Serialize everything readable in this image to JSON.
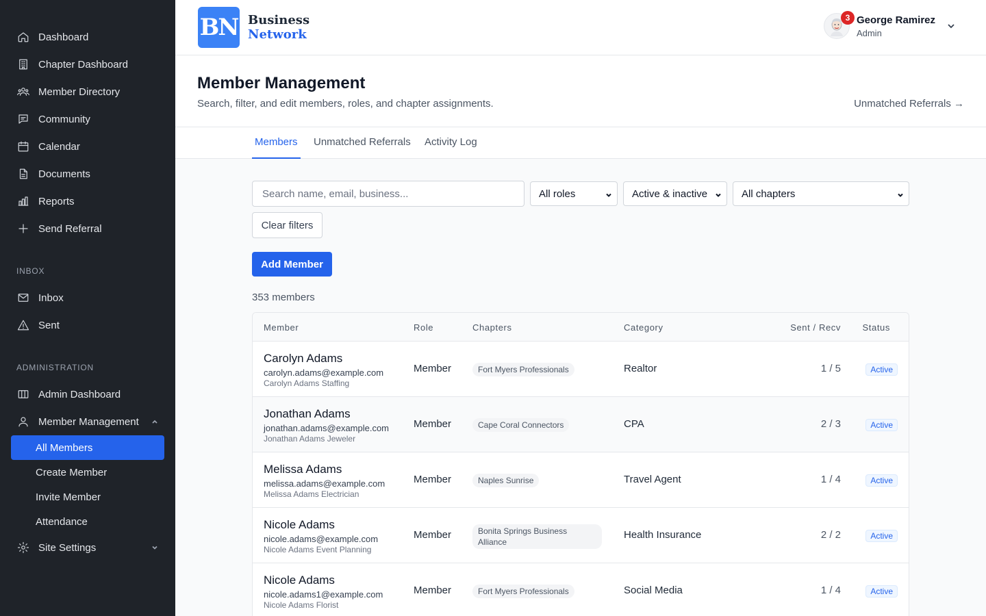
{
  "sidebar": {
    "main": [
      {
        "label": "Dashboard",
        "icon": "home-icon"
      },
      {
        "label": "Chapter Dashboard",
        "icon": "building-icon"
      },
      {
        "label": "Member Directory",
        "icon": "users-icon"
      },
      {
        "label": "Community",
        "icon": "chat-icon"
      },
      {
        "label": "Calendar",
        "icon": "calendar-icon"
      },
      {
        "label": "Documents",
        "icon": "document-icon"
      },
      {
        "label": "Reports",
        "icon": "bar-chart-icon"
      },
      {
        "label": "Send Referral",
        "icon": "plus-icon"
      }
    ],
    "inbox_heading": "INBOX",
    "inbox": [
      {
        "label": "Inbox",
        "icon": "mail-icon"
      },
      {
        "label": "Sent",
        "icon": "warning-triangle-icon"
      }
    ],
    "admin_heading": "ADMINISTRATION",
    "admin": [
      {
        "label": "Admin Dashboard",
        "icon": "columns-icon"
      },
      {
        "label": "Member Management",
        "icon": "user-icon"
      }
    ],
    "member_sub": [
      "All Members",
      "Create Member",
      "Invite Member",
      "Attendance"
    ],
    "site_settings": "Site Settings"
  },
  "header": {
    "logo_mark": "BN",
    "logo_line1": "Business",
    "logo_line2": "Network",
    "notification_count": "3",
    "user_name": "George Ramirez",
    "user_role": "Admin"
  },
  "page": {
    "title": "Member Management",
    "subtitle": "Search, filter, and edit members, roles, and chapter assignments.",
    "unmatched_link": "Unmatched Referrals →"
  },
  "tabs": [
    "Members",
    "Unmatched Referrals",
    "Activity Log"
  ],
  "filters": {
    "search_placeholder": "Search name, email, business...",
    "role": "All roles",
    "status": "Active & inactive",
    "chapter": "All chapters",
    "clear": "Clear filters"
  },
  "add_member": "Add Member",
  "member_count": "353 members",
  "table": {
    "headers": [
      "Member",
      "Role",
      "Chapters",
      "Category",
      "Sent / Recv",
      "Status"
    ],
    "rows": [
      {
        "name": "Carolyn Adams",
        "email": "carolyn.adams@example.com",
        "business": "Carolyn Adams Staffing",
        "role": "Member",
        "chapter": "Fort Myers Professionals",
        "category": "Realtor",
        "sent_recv": "1 / 5",
        "status": "Active"
      },
      {
        "name": "Jonathan Adams",
        "email": "jonathan.adams@example.com",
        "business": "Jonathan Adams Jeweler",
        "role": "Member",
        "chapter": "Cape Coral Connectors",
        "category": "CPA",
        "sent_recv": "2 / 3",
        "status": "Active"
      },
      {
        "name": "Melissa Adams",
        "email": "melissa.adams@example.com",
        "business": "Melissa Adams Electrician",
        "role": "Member",
        "chapter": "Naples Sunrise",
        "category": "Travel Agent",
        "sent_recv": "1 / 4",
        "status": "Active"
      },
      {
        "name": "Nicole Adams",
        "email": "nicole.adams@example.com",
        "business": "Nicole Adams Event Planning",
        "role": "Member",
        "chapter": "Bonita Springs Business Alliance",
        "category": "Health Insurance",
        "sent_recv": "2 / 2",
        "status": "Active"
      },
      {
        "name": "Nicole Adams",
        "email": "nicole.adams1@example.com",
        "business": "Nicole Adams Florist",
        "role": "Member",
        "chapter": "Fort Myers Professionals",
        "category": "Social Media",
        "sent_recv": "1 / 4",
        "status": "Active"
      }
    ]
  }
}
